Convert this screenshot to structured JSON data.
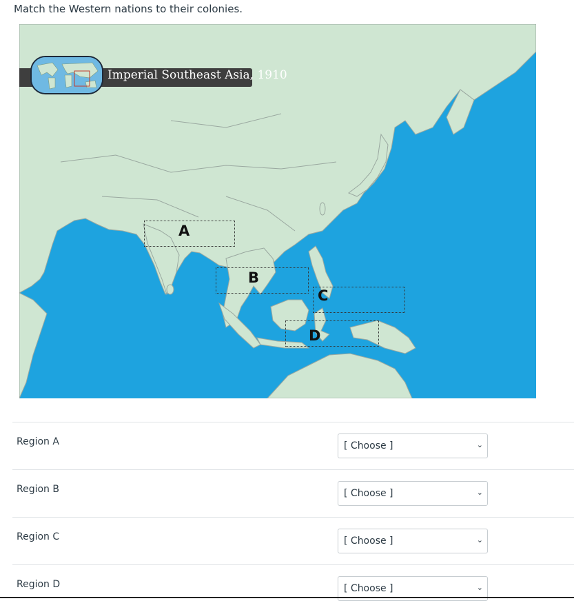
{
  "question": "Match the Western nations to their colonies.",
  "map": {
    "title": "Imperial Southeast Asia, 1910",
    "labels": [
      "A",
      "B",
      "C",
      "D"
    ],
    "colors": {
      "ocean": "#1ea3df",
      "land": "#cfe6d2",
      "border": "#9aa8a0"
    }
  },
  "rows": [
    {
      "label": "Region A",
      "select": "[ Choose ]"
    },
    {
      "label": "Region B",
      "select": "[ Choose ]"
    },
    {
      "label": "Region C",
      "select": "[ Choose ]"
    },
    {
      "label": "Region D",
      "select": "[ Choose ]"
    }
  ]
}
